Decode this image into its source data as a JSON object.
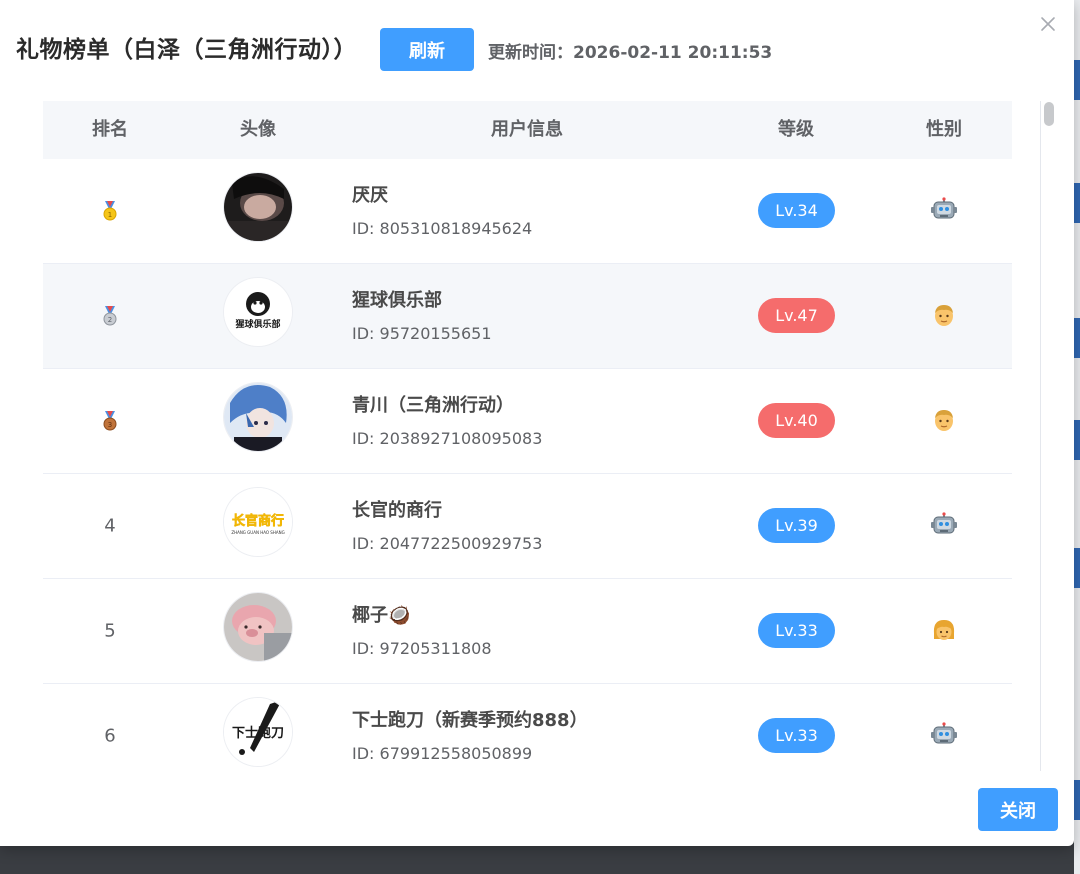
{
  "dialog": {
    "title": "礼物榜单（白泽（三角洲行动））",
    "refresh_label": "刷新",
    "update_time": "更新时间：2026-02-11 20:11:53",
    "close_label": "关闭"
  },
  "table": {
    "headers": [
      "排名",
      "头像",
      "用户信息",
      "等级",
      "性别"
    ],
    "rows": [
      {
        "rank": "",
        "medal": "gold-medal-icon",
        "name": "厌厌",
        "id": "ID: 805310818945624",
        "level": "Lv.34",
        "level_color": "#409eff",
        "gender": "robot-icon"
      },
      {
        "rank": "",
        "medal": "silver-medal-icon",
        "name": "猩球俱乐部",
        "id": "ID: 95720155651",
        "level": "Lv.47",
        "level_color": "#f56c6c",
        "gender": "man-icon"
      },
      {
        "rank": "",
        "medal": "bronze-medal-icon",
        "name": "青川（三角洲行动）",
        "id": "ID: 2038927108095083",
        "level": "Lv.40",
        "level_color": "#f56c6c",
        "gender": "man-icon"
      },
      {
        "rank": "4",
        "medal": "",
        "name": "长官的商行",
        "id": "ID: 2047722500929753",
        "level": "Lv.39",
        "level_color": "#409eff",
        "gender": "robot-icon"
      },
      {
        "rank": "5",
        "medal": "",
        "name": "椰子🥥",
        "id": "ID: 97205311808",
        "level": "Lv.33",
        "level_color": "#409eff",
        "gender": "woman-icon"
      },
      {
        "rank": "6",
        "medal": "",
        "name": "下士跑刀（新赛季预约888）",
        "id": "ID: 679912558050899",
        "level": "Lv.33",
        "level_color": "#409eff",
        "gender": "robot-icon"
      }
    ]
  },
  "avatars": {
    "a2_text": "猩球俱乐部",
    "a4_text": "长官商行",
    "a4_sub": "ZHANG GUAN HAO SHANG",
    "a6_text": "下士跑刀"
  },
  "colors": {
    "primary": "#409eff",
    "danger": "#f56c6c",
    "header_bg": "#f5f7fa"
  }
}
